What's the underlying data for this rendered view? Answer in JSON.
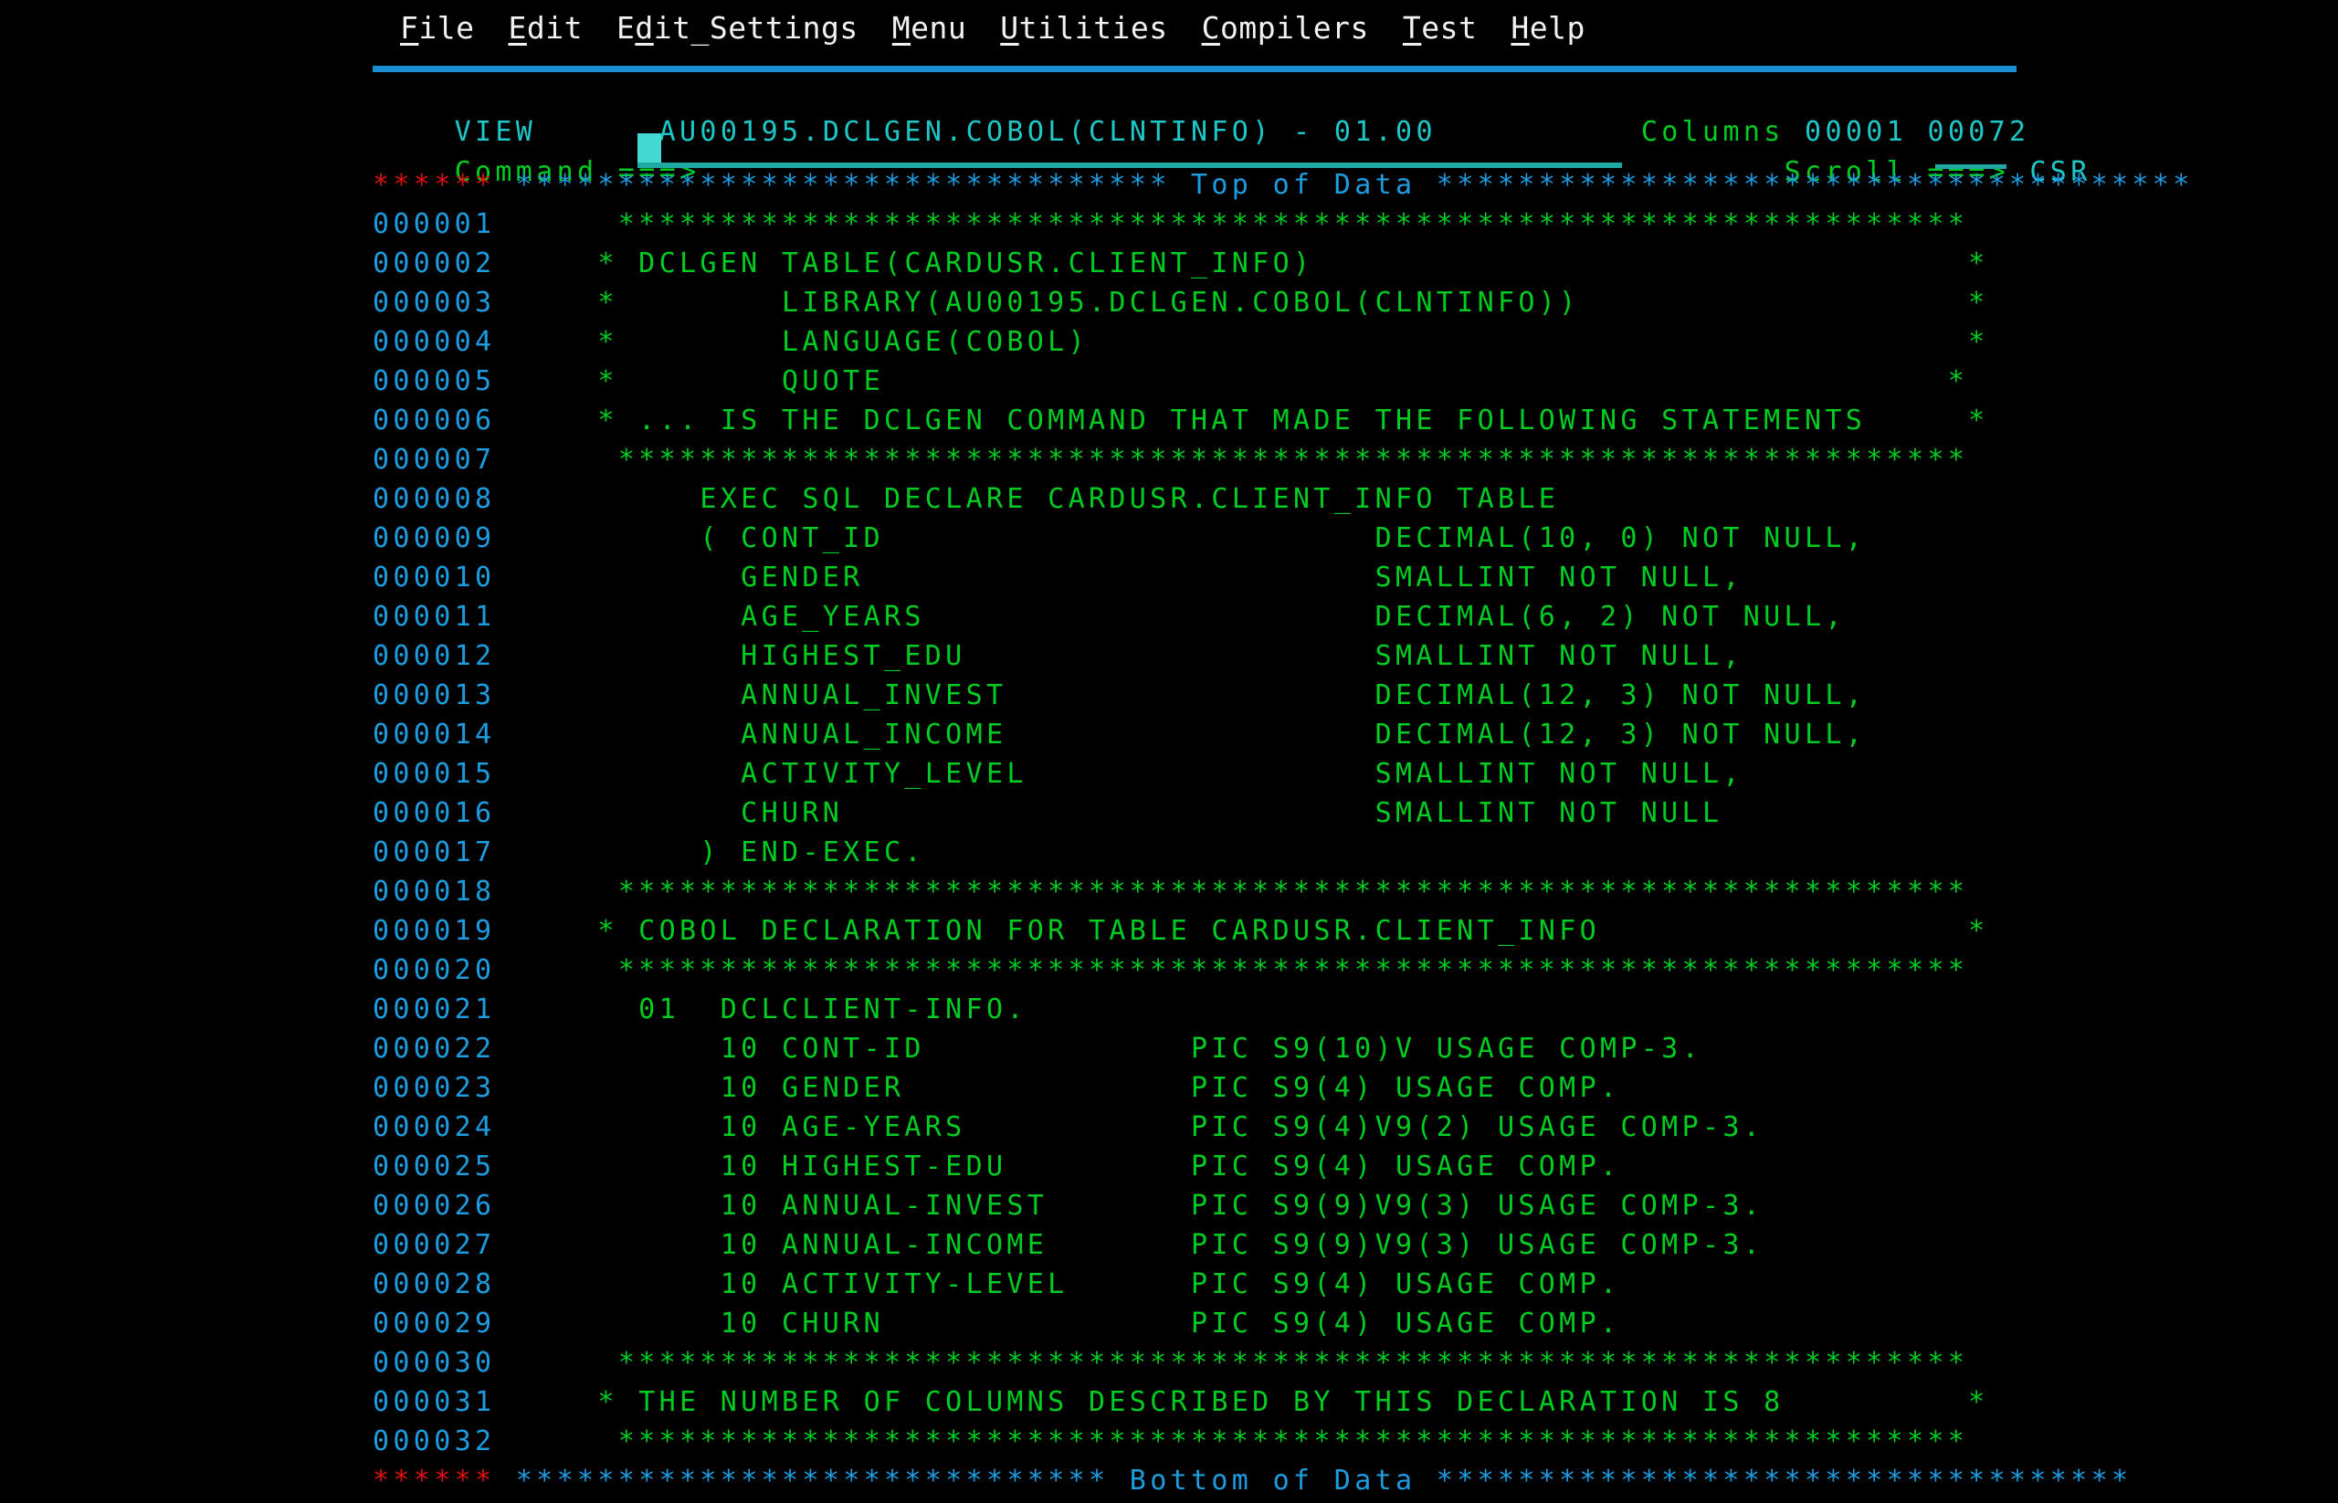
{
  "terminal": {
    "type": "ispf-3270-view",
    "columns": 80,
    "background": "#000000",
    "colors": {
      "green": "#00cc22",
      "cyan": "#1ec8c8",
      "turquoise": "#22d3cf",
      "blue": "#1e9ce0",
      "red": "#e01010",
      "white": "#f0f0f0",
      "rule": "#1b8fd6"
    }
  },
  "menubar": {
    "items": [
      {
        "label": "File",
        "mnemonic": "F"
      },
      {
        "label": "Edit",
        "mnemonic": "E"
      },
      {
        "label": "Edit_Settings",
        "mnemonic": "d"
      },
      {
        "label": "Menu",
        "mnemonic": "M"
      },
      {
        "label": "Utilities",
        "mnemonic": "U"
      },
      {
        "label": "Compilers",
        "mnemonic": "C"
      },
      {
        "label": "Test",
        "mnemonic": "T"
      },
      {
        "label": "Help",
        "mnemonic": "H"
      }
    ]
  },
  "header": {
    "mode": "VIEW",
    "dataset": "AU00195.DCLGEN.COBOL(CLNTINFO)",
    "separator": "-",
    "version": "01.00",
    "columns_label": "Columns",
    "columns_value": "00001 00072",
    "command_label": "Command ===>",
    "command_value": "",
    "command_placeholder": "",
    "scroll_label": "Scroll ===>",
    "scroll_value": "CSR"
  },
  "markers": {
    "prefix": "******",
    "top_label": "Top of Data",
    "bottom_label": "Bottom of Data",
    "top_fill_left": "********************************",
    "top_fill_right": "*************************************",
    "bottom_fill_left": "*****************************",
    "bottom_fill_right": "**********************************"
  },
  "lines": [
    {
      "no": "000001",
      "text": "      ******************************************************************"
    },
    {
      "no": "000002",
      "text": "     * DCLGEN TABLE(CARDUSR.CLIENT_INFO)                                *"
    },
    {
      "no": "000003",
      "text": "     *        LIBRARY(AU00195.DCLGEN.COBOL(CLNTINFO))                   *"
    },
    {
      "no": "000004",
      "text": "     *        LANGUAGE(COBOL)                                           *"
    },
    {
      "no": "000005",
      "text": "     *        QUOTE                                                    *"
    },
    {
      "no": "000006",
      "text": "     * ... IS THE DCLGEN COMMAND THAT MADE THE FOLLOWING STATEMENTS     *"
    },
    {
      "no": "000007",
      "text": "      ******************************************************************"
    },
    {
      "no": "000008",
      "text": "          EXEC SQL DECLARE CARDUSR.CLIENT_INFO TABLE"
    },
    {
      "no": "000009",
      "text": "          ( CONT_ID                        DECIMAL(10, 0) NOT NULL,"
    },
    {
      "no": "000010",
      "text": "            GENDER                         SMALLINT NOT NULL,"
    },
    {
      "no": "000011",
      "text": "            AGE_YEARS                      DECIMAL(6, 2) NOT NULL,"
    },
    {
      "no": "000012",
      "text": "            HIGHEST_EDU                    SMALLINT NOT NULL,"
    },
    {
      "no": "000013",
      "text": "            ANNUAL_INVEST                  DECIMAL(12, 3) NOT NULL,"
    },
    {
      "no": "000014",
      "text": "            ANNUAL_INCOME                  DECIMAL(12, 3) NOT NULL,"
    },
    {
      "no": "000015",
      "text": "            ACTIVITY_LEVEL                 SMALLINT NOT NULL,"
    },
    {
      "no": "000016",
      "text": "            CHURN                          SMALLINT NOT NULL"
    },
    {
      "no": "000017",
      "text": "          ) END-EXEC."
    },
    {
      "no": "000018",
      "text": "      ******************************************************************"
    },
    {
      "no": "000019",
      "text": "     * COBOL DECLARATION FOR TABLE CARDUSR.CLIENT_INFO                  *"
    },
    {
      "no": "000020",
      "text": "      ******************************************************************"
    },
    {
      "no": "000021",
      "text": "       01  DCLCLIENT-INFO."
    },
    {
      "no": "000022",
      "text": "           10 CONT-ID             PIC S9(10)V USAGE COMP-3."
    },
    {
      "no": "000023",
      "text": "           10 GENDER              PIC S9(4) USAGE COMP."
    },
    {
      "no": "000024",
      "text": "           10 AGE-YEARS           PIC S9(4)V9(2) USAGE COMP-3."
    },
    {
      "no": "000025",
      "text": "           10 HIGHEST-EDU         PIC S9(4) USAGE COMP."
    },
    {
      "no": "000026",
      "text": "           10 ANNUAL-INVEST       PIC S9(9)V9(3) USAGE COMP-3."
    },
    {
      "no": "000027",
      "text": "           10 ANNUAL-INCOME       PIC S9(9)V9(3) USAGE COMP-3."
    },
    {
      "no": "000028",
      "text": "           10 ACTIVITY-LEVEL      PIC S9(4) USAGE COMP."
    },
    {
      "no": "000029",
      "text": "           10 CHURN               PIC S9(4) USAGE COMP."
    },
    {
      "no": "000030",
      "text": "      ******************************************************************"
    },
    {
      "no": "000031",
      "text": "     * THE NUMBER OF COLUMNS DESCRIBED BY THIS DECLARATION IS 8         *"
    },
    {
      "no": "000032",
      "text": "      ******************************************************************"
    }
  ]
}
